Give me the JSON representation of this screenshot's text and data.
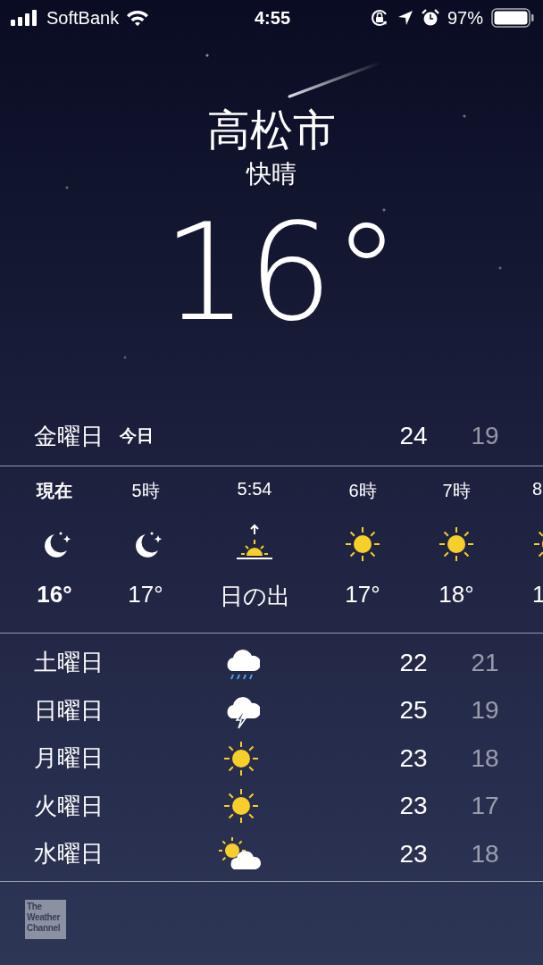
{
  "status_bar": {
    "carrier": "SoftBank",
    "time": "4:55",
    "battery": "97%"
  },
  "location": {
    "city": "高松市",
    "condition": "快晴",
    "temperature": "16°"
  },
  "today": {
    "day": "金曜日",
    "label": "今日",
    "high": "24",
    "low": "19"
  },
  "hourly": [
    {
      "time": "現在",
      "kind": "moon",
      "temp": "16°",
      "now": true
    },
    {
      "time": "5時",
      "kind": "moon",
      "temp": "17°",
      "now": false
    },
    {
      "time": "5:54",
      "kind": "sunrise",
      "temp": "日の出",
      "now": false
    },
    {
      "time": "6時",
      "kind": "sun",
      "temp": "17°",
      "now": false
    },
    {
      "time": "7時",
      "kind": "sun",
      "temp": "18°",
      "now": false
    },
    {
      "time": "8",
      "kind": "sun",
      "temp": "1",
      "now": false
    }
  ],
  "daily": [
    {
      "day": "土曜日",
      "kind": "rain",
      "high": "22",
      "low": "21"
    },
    {
      "day": "日曜日",
      "kind": "thunder",
      "high": "25",
      "low": "19"
    },
    {
      "day": "月曜日",
      "kind": "sun",
      "high": "23",
      "low": "18"
    },
    {
      "day": "火曜日",
      "kind": "sun",
      "high": "23",
      "low": "17"
    },
    {
      "day": "水曜日",
      "kind": "partly_cloudy",
      "high": "23",
      "low": "18"
    }
  ],
  "footer": {
    "logo": "The Weather Channel"
  }
}
